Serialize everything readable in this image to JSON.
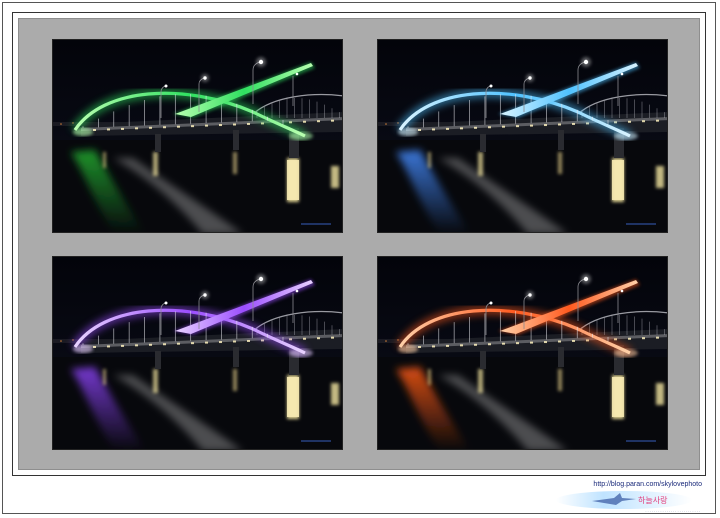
{
  "photos": [
    {
      "id": "green-bridge",
      "accent": "#2fe060",
      "glow": "#b8ffb0",
      "reflect": "#1f9a2c"
    },
    {
      "id": "blue-bridge",
      "accent": "#4fc2ff",
      "glow": "#d8f3ff",
      "reflect": "#3d7be0"
    },
    {
      "id": "violet-bridge",
      "accent": "#9b4dff",
      "glow": "#e8d2ff",
      "reflect": "#7a3bd8"
    },
    {
      "id": "orange-bridge",
      "accent": "#ff5a1f",
      "glow": "#ffd0a8",
      "reflect": "#e05014"
    }
  ],
  "credit": {
    "url": "http://blog.paran.com/skylovephoto",
    "logo_text": "하늘사랑"
  },
  "colors": {
    "page_bg": "#ffffff",
    "matte": "#ababab",
    "night_sky": "#05060b"
  }
}
